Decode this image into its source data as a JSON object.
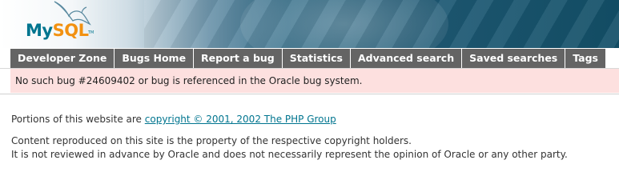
{
  "logo": {
    "my": "My",
    "sql": "SQL",
    "tm": "TM"
  },
  "nav": {
    "items": [
      {
        "label": "Developer Zone"
      },
      {
        "label": "Bugs Home"
      },
      {
        "label": "Report a bug"
      },
      {
        "label": "Statistics"
      },
      {
        "label": "Advanced search"
      },
      {
        "label": "Saved searches"
      },
      {
        "label": "Tags"
      }
    ]
  },
  "error": {
    "message": "No such bug #24609402 or bug is referenced in the Oracle bug system."
  },
  "footer": {
    "portions_prefix": "Portions of this website are ",
    "copyright_link": "copyright © 2001, 2002 The PHP Group",
    "line2": "Content reproduced on this site is the property of the respective copyright holders.",
    "line3": "It is not reviewed in advance by Oracle and does not necessarily represent the opinion of Oracle or any other party."
  },
  "colors": {
    "nav_bg": "#646464",
    "error_bg": "#fde0df",
    "link": "#00758f",
    "logo_blue": "#00758f",
    "logo_orange": "#f29111"
  }
}
